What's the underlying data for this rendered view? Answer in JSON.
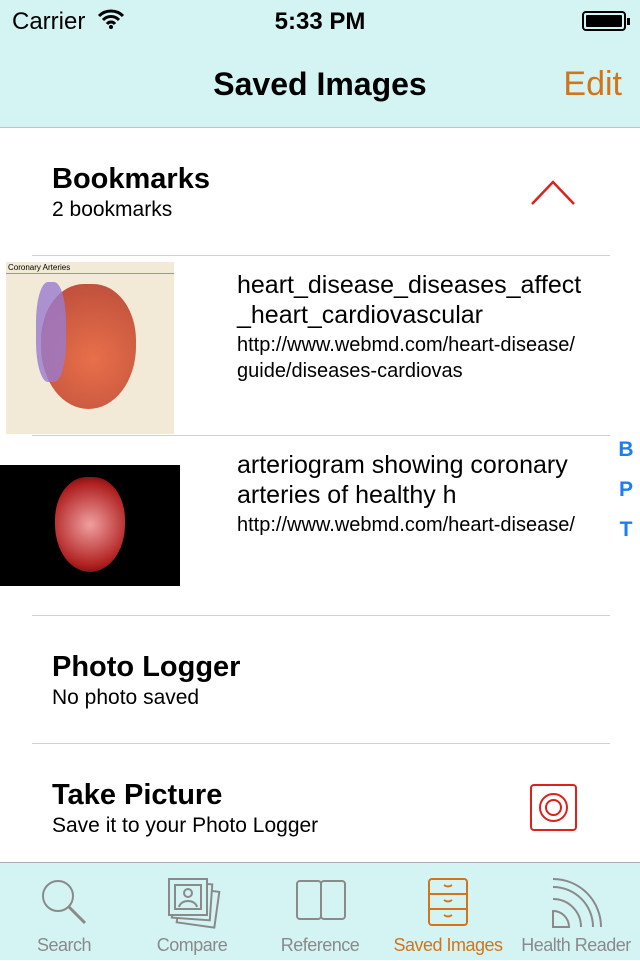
{
  "status": {
    "carrier": "Carrier",
    "time": "5:33 PM"
  },
  "nav": {
    "title": "Saved Images",
    "edit": "Edit"
  },
  "bookmarks": {
    "title": "Bookmarks",
    "count": "2 bookmarks",
    "items": [
      {
        "title": "heart_disease_diseases_affect_heart_cardiovascular",
        "url": "http://www.webmd.com/heart-disease/guide/diseases-cardiovas",
        "thumb_caption": "Coronary Arteries"
      },
      {
        "title": "arteriogram showing coronary arteries of healthy h",
        "url": "http://www.webmd.com/heart-disease/"
      }
    ]
  },
  "index": [
    "B",
    "P",
    "T"
  ],
  "photo_logger": {
    "title": "Photo Logger",
    "sub": "No photo saved"
  },
  "take_picture": {
    "title": "Take Picture",
    "sub": "Save it to your Photo Logger"
  },
  "tabs": [
    {
      "label": "Search",
      "icon": "search-icon"
    },
    {
      "label": "Compare",
      "icon": "photos-icon"
    },
    {
      "label": "Reference",
      "icon": "book-icon"
    },
    {
      "label": "Saved Images",
      "icon": "cabinet-icon",
      "active": true
    },
    {
      "label": "Health Reader",
      "icon": "feed-icon"
    }
  ],
  "colors": {
    "accent": "#d2741a",
    "bar": "#d4f4f4",
    "index": "#1a7ff0",
    "red": "#e0201a"
  }
}
